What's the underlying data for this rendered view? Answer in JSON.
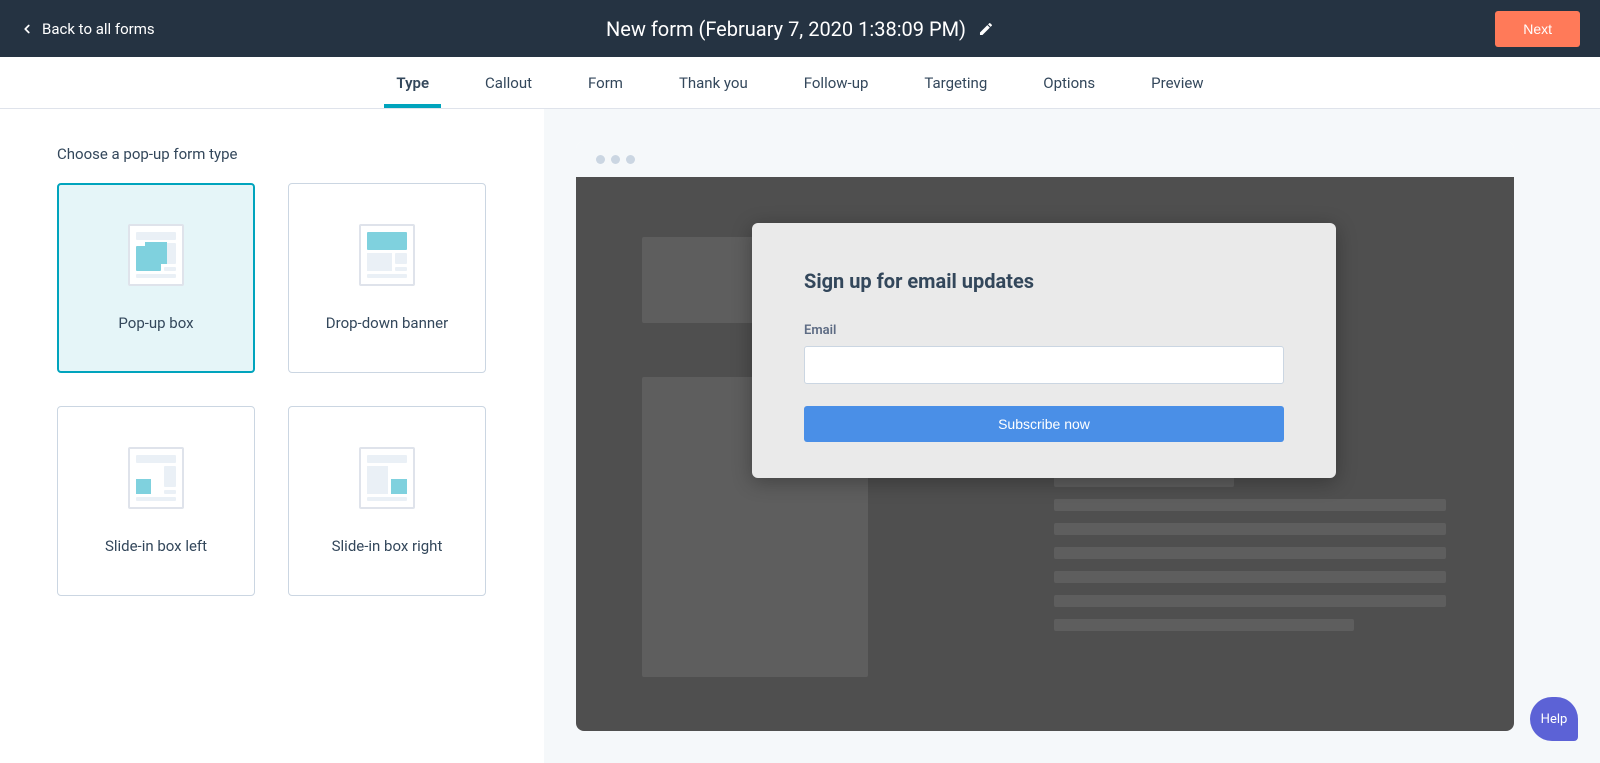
{
  "header": {
    "back_label": "Back to all forms",
    "title": "New form (February 7, 2020 1:38:09 PM)",
    "next_label": "Next"
  },
  "tabs": {
    "items": [
      {
        "label": "Type",
        "active": true
      },
      {
        "label": "Callout",
        "active": false
      },
      {
        "label": "Form",
        "active": false
      },
      {
        "label": "Thank you",
        "active": false
      },
      {
        "label": "Follow-up",
        "active": false
      },
      {
        "label": "Targeting",
        "active": false
      },
      {
        "label": "Options",
        "active": false
      },
      {
        "label": "Preview",
        "active": false
      }
    ]
  },
  "left_panel": {
    "section_title": "Choose a pop-up form type",
    "cards": [
      {
        "label": "Pop-up box",
        "selected": true
      },
      {
        "label": "Drop-down banner",
        "selected": false
      },
      {
        "label": "Slide-in box left",
        "selected": false
      },
      {
        "label": "Slide-in box right",
        "selected": false
      }
    ]
  },
  "preview": {
    "popup_title": "Sign up for email updates",
    "email_label": "Email",
    "email_value": "",
    "submit_label": "Subscribe now"
  },
  "help": {
    "label": "Help"
  },
  "colors": {
    "header_bg": "#253342",
    "accent_teal": "#00a4bd",
    "accent_orange": "#ff7a59",
    "popup_button": "#4a8fe7",
    "help_chip": "#5c62d6"
  }
}
